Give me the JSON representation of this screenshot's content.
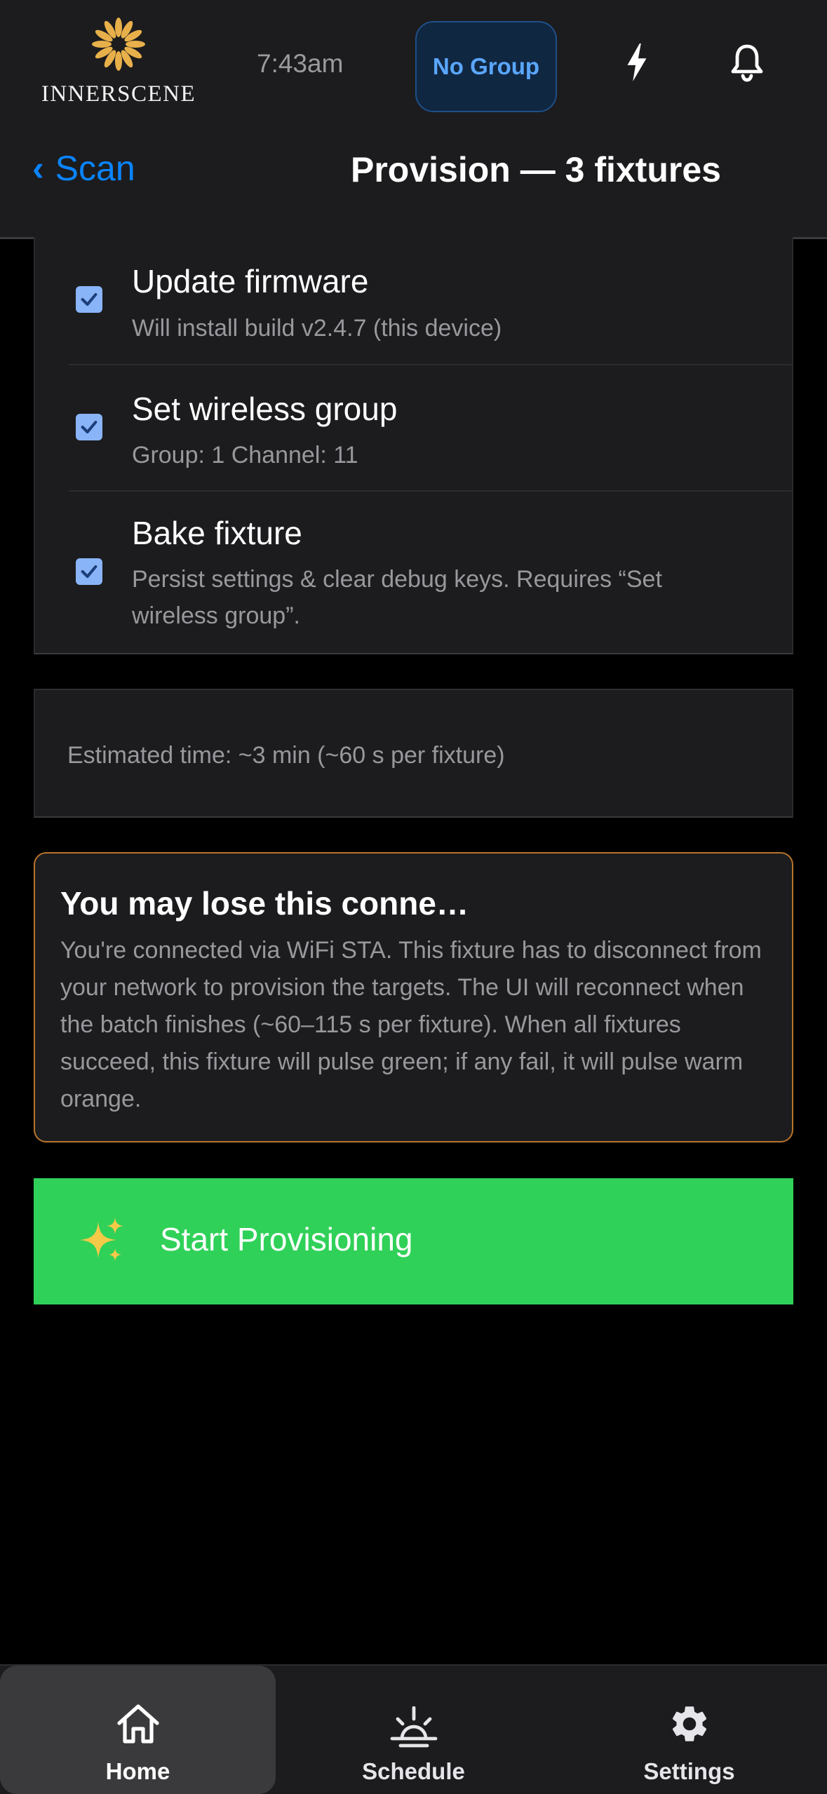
{
  "app": {
    "brand": "INNERSCENE",
    "time": "7:43am",
    "group_button": "No Group",
    "icons": [
      "flower-logo-icon",
      "lightning-bolt-icon",
      "bell-icon"
    ],
    "brand_color": "#e8b04a"
  },
  "header": {
    "back_label": "Scan",
    "back_chevron": "‹",
    "title": "Provision — 3 fixtures"
  },
  "options": [
    {
      "label": "Update firmware",
      "description": "Will install build v2.4.7 (this device)",
      "checked": true
    },
    {
      "label": "Set wireless group",
      "description": "Group: 1 Channel: 11",
      "checked": true
    },
    {
      "label": "Bake fixture",
      "description": "Persist settings & clear debug keys. Requires “Set wireless group”.",
      "checked": true
    }
  ],
  "estimate": "Estimated time: ~3 min (~60 s per fixture)",
  "warning": {
    "title": "You may lose this conne…",
    "body": "You're connected via WiFi STA. This fixture has to disconnect from your network to provision the targets. The UI will reconnect when the batch finishes (~60–115 s per fixture). When all fixtures succeed, this fixture will pulse green; if any fail, it will pulse warm orange.",
    "border_color": "#b8742a"
  },
  "start_button": {
    "icon": "sparkles-icon",
    "label": "Start Provisioning",
    "color": "#30d158"
  },
  "nav": [
    {
      "label": "Home",
      "icon": "home-icon",
      "active": true
    },
    {
      "label": "Schedule",
      "icon": "sunrise-icon",
      "active": false
    },
    {
      "label": "Settings",
      "icon": "gear-icon",
      "active": false
    }
  ]
}
